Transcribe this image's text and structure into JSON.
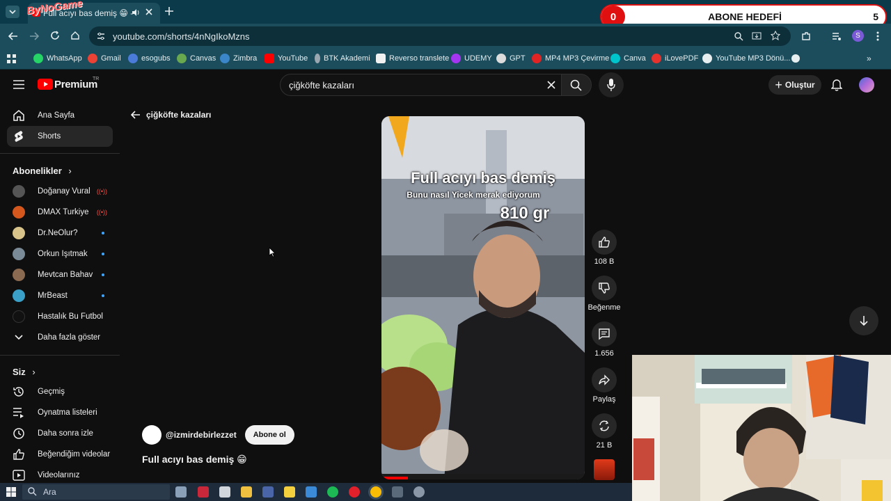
{
  "browser": {
    "tab_title": "Full acıyı bas demiş 😁 - YouTube",
    "url": "youtube.com/shorts/4nNgIkoMzns",
    "profile_initial": "S",
    "bookmarks": [
      "WhatsApp",
      "Gmail",
      "esogubs",
      "Canvas",
      "Zimbra",
      "YouTube",
      "BTK Akademi",
      "Reverso translete",
      "UDEMY",
      "GPT",
      "MP4 MP3 Çevirme",
      "Canva",
      "iLovePDF",
      "YouTube MP3 Dönü..."
    ]
  },
  "overlay_widget": {
    "count": "0",
    "label": "ABONE HEDEFİ",
    "goal": "5",
    "brand": "ByNoGame"
  },
  "youtube": {
    "logo": "Premium",
    "region": "TR",
    "search_query": "çiğköfte  kazaları",
    "create_label": "Oluştur",
    "sidebar": {
      "home": "Ana Sayfa",
      "shorts": "Shorts",
      "subscriptions_header": "Abonelikler",
      "channels": [
        "Doğanay Vural",
        "DMAX Turkiye",
        "Dr.NeOlur?",
        "Orkun Işıtmak",
        "Mevtcan Bahav",
        "MrBeast",
        "Hastalık Bu Futbol"
      ],
      "show_more": "Daha fazla göster",
      "you_header": "Siz",
      "you_items": [
        "Geçmiş",
        "Oynatma listeleri",
        "Daha sonra izle",
        "Beğendiğim videolar",
        "Videolarınız"
      ]
    },
    "back_label": "çiğköfte kazaları",
    "video": {
      "caption_main": "Full acıyı bas demiş",
      "caption_sub": "Bunu nasıl Yicek merak ediyorum",
      "caption_weight": "810 gr"
    },
    "actions": {
      "likes": "108 B",
      "dislike": "Beğenme",
      "comments": "1.656",
      "share": "Paylaş",
      "remix": "21 B"
    },
    "channel_handle": "@izmirdebirlezzet",
    "subscribe_label": "Abone ol",
    "short_title": "Full acıyı bas demiş 😁"
  },
  "taskbar": {
    "search_placeholder": "Ara"
  }
}
